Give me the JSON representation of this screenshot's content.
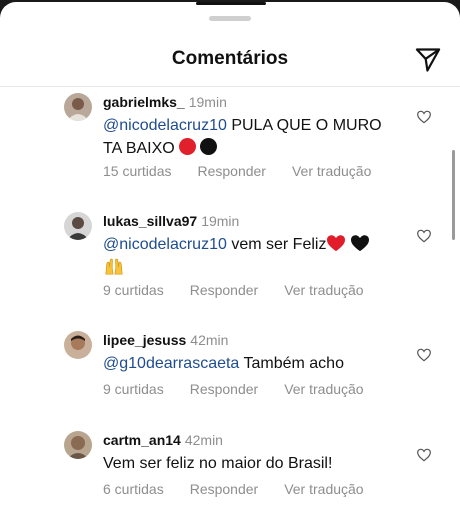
{
  "header": {
    "title": "Comentários"
  },
  "comments": [
    {
      "username": "gabrielmks_",
      "time": "19min",
      "mention": "@nicodelacruz10",
      "text": " PULA QUE O MURO TA BAIXO",
      "likes": "15 curtidas",
      "reply": "Responder",
      "translate": "Ver tradução"
    },
    {
      "username": "lukas_sillva97",
      "time": "19min",
      "mention": "@nicodelacruz10",
      "text": " vem ser Feliz",
      "likes": "9 curtidas",
      "reply": "Responder",
      "translate": "Ver tradução"
    },
    {
      "username": "lipee_jesuss",
      "time": "42min",
      "mention": "@g10dearrascaeta",
      "text": " Também acho",
      "likes": "9 curtidas",
      "reply": "Responder",
      "translate": "Ver tradução"
    },
    {
      "username": "cartm_an14",
      "time": "42min",
      "mention": "",
      "text": "Vem ser feliz no maior do Brasil!",
      "likes": "6 curtidas",
      "reply": "Responder",
      "translate": "Ver tradução"
    }
  ]
}
